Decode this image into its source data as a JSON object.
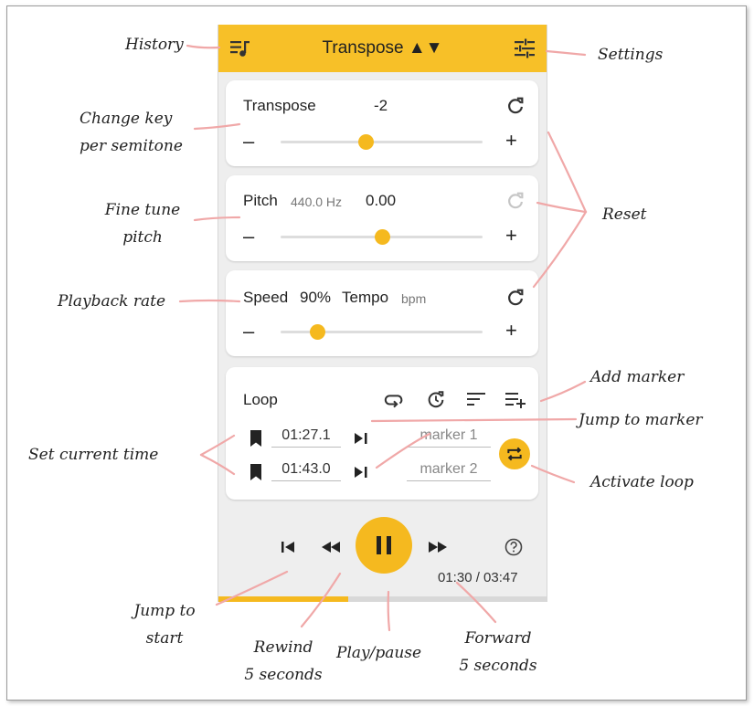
{
  "appbar": {
    "title": "Transpose ▲▼"
  },
  "transpose": {
    "label": "Transpose",
    "value": "-2",
    "minus": "–",
    "plus": "+",
    "slider_fraction": 0.42
  },
  "pitch": {
    "label": "Pitch",
    "reference": "440.0 Hz",
    "value": "0.00",
    "minus": "–",
    "plus": "+",
    "slider_fraction": 0.5
  },
  "speed": {
    "label": "Speed",
    "value": "90%",
    "tempo_label": "Tempo",
    "tempo_unit": "bpm",
    "minus": "–",
    "plus": "+",
    "slider_fraction": 0.18
  },
  "loop": {
    "label": "Loop",
    "start_time": "01:27.1",
    "end_time": "01:43.0",
    "marker1_placeholder": "marker 1",
    "marker2_placeholder": "marker 2"
  },
  "player": {
    "time": "01:30 / 03:47",
    "progress_fraction": 0.396
  },
  "annotations": {
    "history": "History",
    "settings": "Settings",
    "change_key_1": "Change key",
    "change_key_2": "per semitone",
    "fine_tune_1": "Fine tune",
    "fine_tune_2": "pitch",
    "reset": "Reset",
    "playback_rate": "Playback rate",
    "add_marker": "Add marker",
    "jump_to_marker": "Jump to marker",
    "set_current_time": "Set current time",
    "activate_loop": "Activate loop",
    "jump_to_start_1": "Jump to",
    "jump_to_start_2": "start",
    "rewind_1": "Rewind",
    "rewind_2": "5 seconds",
    "play_pause": "Play/pause",
    "forward_1": "Forward",
    "forward_2": "5 seconds"
  },
  "colors": {
    "accent": "#f7c028",
    "annotation_line": "#f0a8a8",
    "background": "#eeeeee"
  },
  "icons": [
    "history-icon",
    "settings-icon",
    "reset-icon",
    "bookmark-icon",
    "jump-icon",
    "loop-icon",
    "clock-icon",
    "sort-icon",
    "add-marker-icon",
    "skip-start-icon",
    "rewind-icon",
    "pause-icon",
    "forward-icon",
    "help-icon"
  ]
}
